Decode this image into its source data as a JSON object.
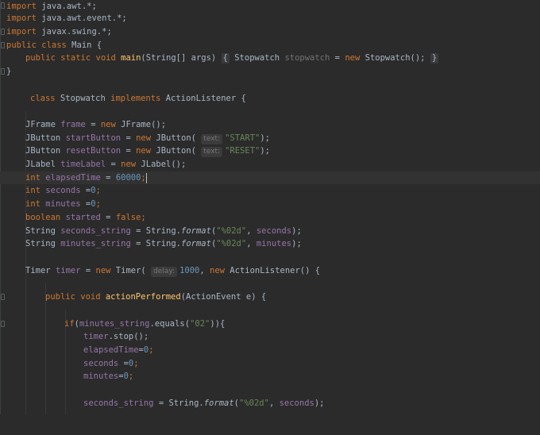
{
  "code": {
    "l1_kw": "import",
    "l1_rest": " java.awt.*;",
    "l2_kw": "import",
    "l2_rest": " java.awt.event.*;",
    "l3_kw": "import",
    "l3_rest": " javax.swing.*;",
    "l4_kw": "public class",
    "l4_rest": " Main {",
    "l5_kw1": "public static void",
    "l5_fn": "main",
    "l5_args": "(String[] args) ",
    "l5_open": "{",
    "l5_type": " Stopwatch ",
    "l5_var": "stopwatch",
    "l5_eq": " = ",
    "l5_new": "new",
    "l5_ctor": " Stopwatch();",
    "l5_close": "}",
    "l6": "}",
    "l8_kw1": "class",
    "l8_name": " Stopwatch ",
    "l8_kw2": "implements",
    "l8_rest": " ActionListener {",
    "l10_type": "JFrame ",
    "l10_var": "frame",
    "l10_eq": " = ",
    "l10_new": "new",
    "l10_rest": " JFrame();",
    "l11_type": "JButton ",
    "l11_var": "startButton",
    "l11_eq": " = ",
    "l11_new": "new",
    "l11_call": " JButton(",
    "l11_hint": "text:",
    "l11_str": "\"START\"",
    "l11_end": ");",
    "l12_type": "JButton ",
    "l12_var": "resetButton",
    "l12_eq": " = ",
    "l12_new": "new",
    "l12_call": " JButton(",
    "l12_hint": "text:",
    "l12_str": "\"RESET\"",
    "l12_end": ");",
    "l13_type": "JLabel ",
    "l13_var": "timeLabel",
    "l13_eq": " = ",
    "l13_new": "new",
    "l13_rest": " JLabel();",
    "l14_kw": "int ",
    "l14_var": "elapsedTime",
    "l14_eq": " = ",
    "l14_num": "60000",
    "l14_end": ";",
    "l15_kw": "int ",
    "l15_var": "seconds",
    "l15_eq": " =",
    "l15_num": "0",
    "l15_end": ";",
    "l16_kw": "int ",
    "l16_var": "minutes",
    "l16_eq": " =",
    "l16_num": "0",
    "l16_end": ";",
    "l17_kw": "boolean ",
    "l17_var": "started",
    "l17_eq": " = ",
    "l17_false": "false",
    "l17_end": ";",
    "l18_type": "String ",
    "l18_var": "seconds_string",
    "l18_eq": " = String.",
    "l18_fmt": "format",
    "l18_open": "(",
    "l18_str": "\"%02d\"",
    "l18_comma": ", ",
    "l18_arg": "seconds",
    "l18_end": ");",
    "l19_type": "String ",
    "l19_var": "minutes_string",
    "l19_eq": " = String.",
    "l19_fmt": "format",
    "l19_open": "(",
    "l19_str": "\"%02d\"",
    "l19_comma": ", ",
    "l19_arg": "minutes",
    "l19_end": ");",
    "l21_type": "Timer ",
    "l21_var": "timer",
    "l21_eq": " = ",
    "l21_new": "new",
    "l21_call": " Timer(",
    "l21_hint": "delay:",
    "l21_num": "1000",
    "l21_comma": ", ",
    "l21_new2": "new",
    "l21_rest": " ActionListener() {",
    "l23_kw": "public void ",
    "l23_fn": "actionPerformed",
    "l23_rest": "(ActionEvent e) {",
    "l25_kw": "if",
    "l25_open": "(",
    "l25_var": "minutes_string",
    "l25_mid": ".equals(",
    "l25_str": "\"02\"",
    "l25_end": ")){",
    "l26_var": "timer",
    "l26_rest": ".stop();",
    "l27_var": "elapsedTime",
    "l27_eq": "=",
    "l27_num": "0",
    "l27_end": ";",
    "l28_var": "seconds",
    "l28_eq": " =",
    "l28_num": "0",
    "l28_end": ";",
    "l29_var": "minutes",
    "l29_eq": "=",
    "l29_num": "0",
    "l29_end": ";",
    "l31_var": "seconds_string",
    "l31_eq": " = String.",
    "l31_fmt": "format",
    "l31_open": "(",
    "l31_str": "\"%02d\"",
    "l31_comma": ", ",
    "l31_arg": "seconds",
    "l31_end": ");"
  },
  "colors": {
    "background": "#2b2b2b",
    "keyword": "#cc7832",
    "field": "#9876aa",
    "string": "#6a8759",
    "number": "#6897bb",
    "function": "#ffc66d",
    "text": "#a9b7c6"
  }
}
